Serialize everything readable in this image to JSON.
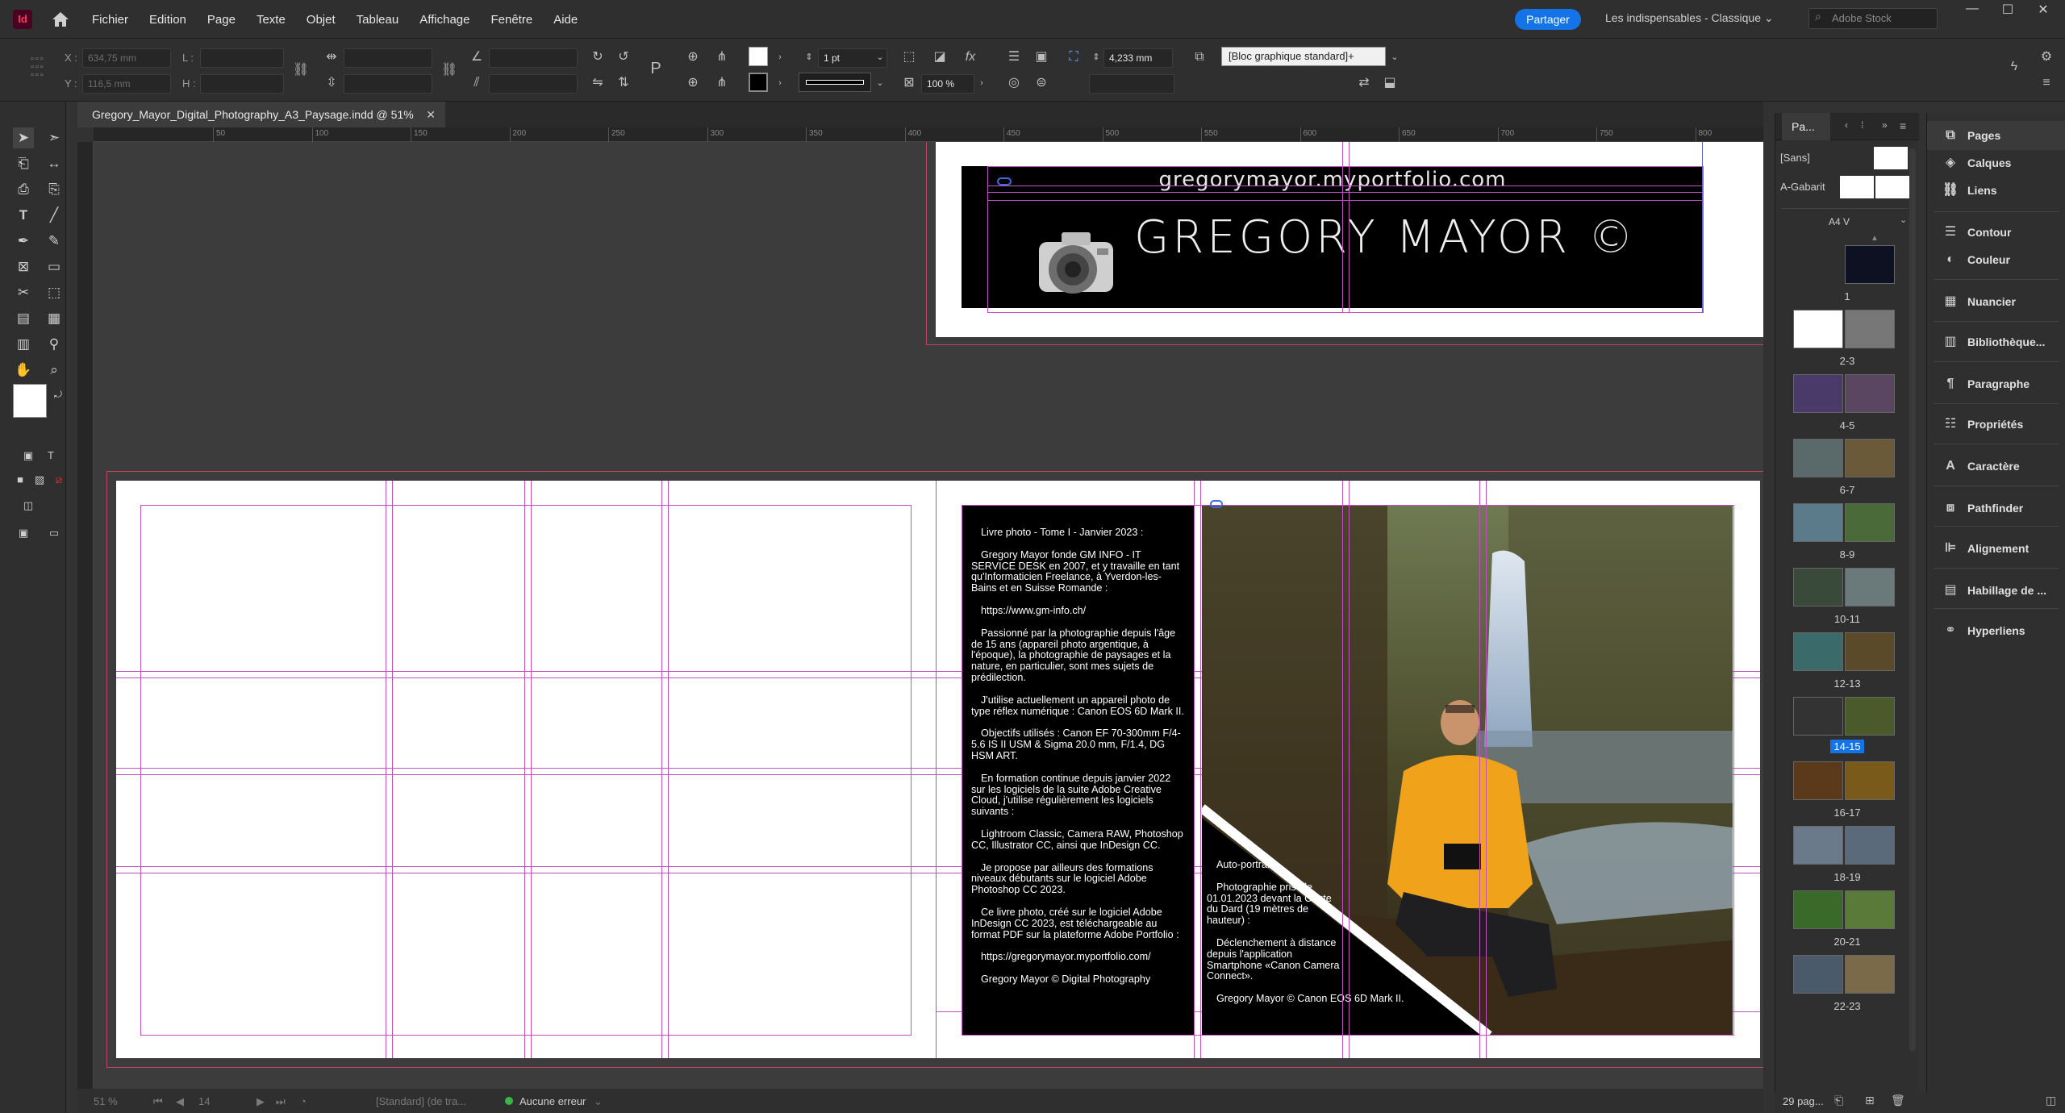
{
  "app": {
    "logo": "Id"
  },
  "menu": [
    "Fichier",
    "Edition",
    "Page",
    "Texte",
    "Objet",
    "Tableau",
    "Affichage",
    "Fenêtre",
    "Aide"
  ],
  "header": {
    "share": "Partager",
    "workspace": "Les indispensables - Classique",
    "search_placeholder": "Adobe Stock"
  },
  "control": {
    "x_label": "X :",
    "x_value": "634,75 mm",
    "y_label": "Y :",
    "y_value": "116,5 mm",
    "w_label": "L :",
    "h_label": "H :",
    "stroke_weight": "1 pt",
    "scale": "100 %",
    "offset": "4,233 mm",
    "object_style": "[Bloc graphique standard]+"
  },
  "document": {
    "tab_title": "Gregory_Mayor_Digital_Photography_A3_Paysage.indd @ 51%",
    "close": "✕"
  },
  "ruler": [
    "50",
    "100",
    "150",
    "200",
    "250",
    "300",
    "350",
    "400",
    "450",
    "500",
    "550",
    "600",
    "650",
    "700",
    "750",
    "800"
  ],
  "banner": {
    "url": "gregorymayor.myportfolio.com",
    "name": "GREGORY MAYOR ©"
  },
  "text_block": {
    "paragraphs": [
      "Livre photo - Tome I - Janvier 2023 :",
      "Gregory Mayor fonde GM INFO - IT SERVICE DESK en 2007, et y travaille en tant qu'Informaticien Freelance, à Yverdon-les-Bains et en Suisse Romande :",
      "https://www.gm-info.ch/",
      "Passionné par la photographie depuis l'âge de 15 ans (appareil photo argentique, à l'époque), la photographie de paysages et la nature, en particulier, sont mes sujets de prédilection.",
      "J'utilise actuellement un appareil photo de type réflex numérique : Canon EOS 6D Mark II.",
      "Objectifs utilisés : Canon EF 70-300mm F/4-5.6 IS II USM & Sigma 20.0 mm, F/1.4, DG HSM ART.",
      "En formation continue depuis janvier 2022 sur les logiciels de la suite Adobe Creative Cloud, j'utilise régulièrement les logiciels suivants :",
      "Lightroom Classic, Camera RAW, Photoshop CC, Illustrator CC, ainsi que InDesign CC.",
      "Je propose par ailleurs des formations niveaux débutants sur le logiciel Adobe Photoshop CC 2023.",
      "Ce livre photo, créé sur le logiciel Adobe InDesign CC 2023, est téléchargeable au format PDF sur la plateforme Adobe Portfolio :",
      "https://gregorymayor.myportfolio.com/",
      "Gregory Mayor © Digital Photography"
    ]
  },
  "photo_caption": {
    "lines": [
      "Auto-portrait :",
      "Photographie prise le 01.01.2023 devant la Chute du Dard (19 mètres de hauteur) :",
      "Déclenchement à distance depuis l'application Smartphone «Canon Camera Connect».",
      "Gregory Mayor © Canon EOS 6D Mark II."
    ]
  },
  "status": {
    "zoom": "51 %",
    "page": "14",
    "style": "[Standard] (de tra...",
    "preflight": "Aucune erreur"
  },
  "pages_panel": {
    "tab": "Pa...",
    "masters": [
      {
        "name": "[Sans]"
      },
      {
        "name": "A-Gabarit"
      }
    ],
    "master_selector": "A4 V",
    "page_labels": [
      "1",
      "2-3",
      "4-5",
      "6-7",
      "8-9",
      "10-11",
      "12-13",
      "14-15",
      "16-17",
      "18-19",
      "20-21",
      "22-23"
    ],
    "selected": "14-15",
    "count": "29 pag..."
  },
  "dock": {
    "items": [
      "Pages",
      "Calques",
      "Liens",
      "Contour",
      "Couleur",
      "Nuancier",
      "Bibliothèque...",
      "Paragraphe",
      "Propriétés",
      "Caractère",
      "Pathfinder",
      "Alignement",
      "Habillage de ...",
      "Hyperliens"
    ]
  },
  "icons": {
    "home": "home-icon",
    "search": "search-icon",
    "camera": "camera-icon"
  },
  "colors": {
    "accent": "#1473e6",
    "guide": "#c44ec4",
    "bleed": "#c4455f"
  }
}
